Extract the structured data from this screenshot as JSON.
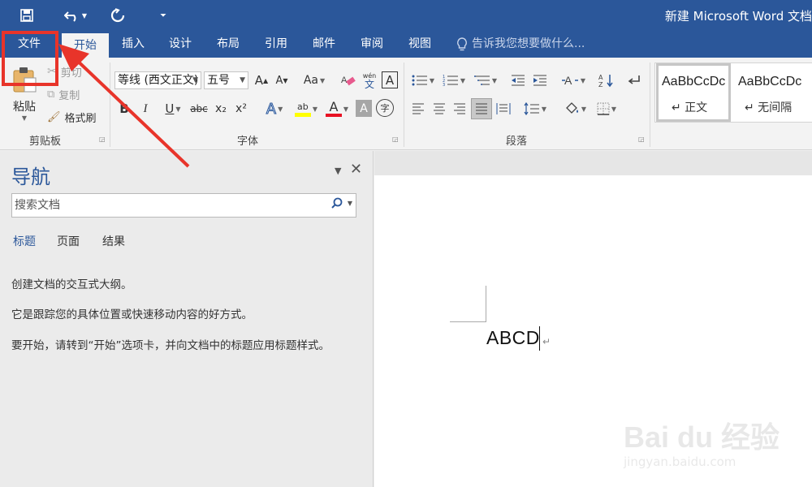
{
  "titlebar": {
    "title": "新建 Microsoft Word 文档",
    "save_icon": "save-icon",
    "undo_icon": "undo-icon",
    "redo_icon": "redo-icon",
    "customize_icon": "customize-qat-icon"
  },
  "tabs": [
    {
      "label": "文件"
    },
    {
      "label": "开始"
    },
    {
      "label": "插入"
    },
    {
      "label": "设计"
    },
    {
      "label": "布局"
    },
    {
      "label": "引用"
    },
    {
      "label": "邮件"
    },
    {
      "label": "审阅"
    },
    {
      "label": "视图"
    }
  ],
  "tellme": {
    "placeholder": "告诉我您想要做什么..."
  },
  "ribbon": {
    "clipboard": {
      "group_label": "剪贴板",
      "paste_label": "粘贴",
      "cut_label": "剪切",
      "copy_label": "复制",
      "format_painter_label": "格式刷"
    },
    "font": {
      "group_label": "字体",
      "font_name": "等线 (西文正文)",
      "font_size": "五号",
      "bold": "B",
      "italic": "I",
      "underline": "U",
      "strike": "abc",
      "subscript": "x₂",
      "superscript": "x²",
      "case_label": "Aa",
      "phonetic_top": "wén",
      "phonetic_bottom": "文",
      "border_char": "A",
      "grow_char": "A",
      "shrink_char": "A",
      "effect_char": "A",
      "highlight_text": "ab",
      "color_char": "A",
      "shading_char": "A",
      "encircle_char": "字",
      "highlight_color": "#ffff00",
      "font_color": "#e81123"
    },
    "paragraph": {
      "group_label": "段落"
    },
    "styles": {
      "items": [
        {
          "sample": "AaBbCcDc",
          "name": "↵ 正文"
        },
        {
          "sample": "AaBbCcDc",
          "name": "↵ 无间隔"
        }
      ]
    }
  },
  "nav": {
    "title": "导航",
    "search_placeholder": "搜索文档",
    "tabs": [
      {
        "label": "标题"
      },
      {
        "label": "页面"
      },
      {
        "label": "结果"
      }
    ],
    "para1": "创建文档的交互式大纲。",
    "para2": "它是跟踪您的具体位置或快速移动内容的好方式。",
    "para3": "要开始，请转到“开始”选项卡，并向文档中的标题应用标题样式。"
  },
  "document": {
    "text": "ABCD",
    "pilcrow": "↵"
  },
  "watermark": {
    "main": "Bai du 经验",
    "sub": "jingyan.baidu.com"
  },
  "colors": {
    "accent": "#2b579a",
    "annotation": "#e8342a"
  }
}
